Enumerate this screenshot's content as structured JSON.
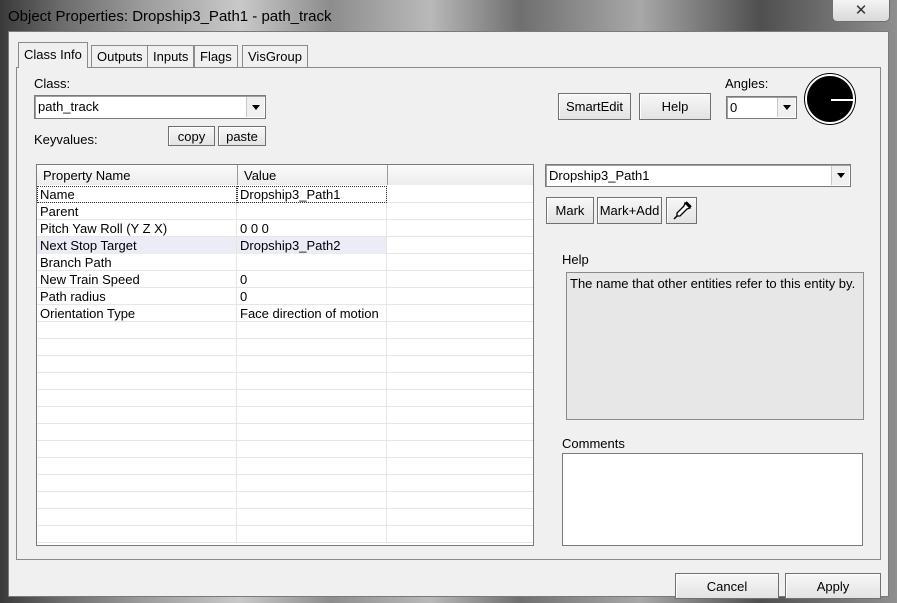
{
  "window": {
    "title": "Object Properties: Dropship3_Path1 - path_track",
    "close_glyph": "✕"
  },
  "tabs": [
    {
      "label": "Class Info",
      "active": true
    },
    {
      "label": "Outputs"
    },
    {
      "label": "Inputs"
    },
    {
      "label": "Flags"
    },
    {
      "label": "VisGroup"
    }
  ],
  "class_section": {
    "label": "Class:",
    "value": "path_track",
    "keyvalues_label": "Keyvalues:",
    "copy_label": "copy",
    "paste_label": "paste"
  },
  "toolbar": {
    "smartedit_label": "SmartEdit",
    "help_label": "Help"
  },
  "angles": {
    "label": "Angles:",
    "value": "0"
  },
  "grid": {
    "columns": [
      "Property Name",
      "Value"
    ],
    "rows": [
      {
        "name": "Name",
        "value": "Dropship3_Path1"
      },
      {
        "name": "Parent",
        "value": ""
      },
      {
        "name": "Pitch Yaw Roll (Y Z X)",
        "value": "0 0 0"
      },
      {
        "name": "Next Stop Target",
        "value": "Dropship3_Path2"
      },
      {
        "name": "Branch Path",
        "value": ""
      },
      {
        "name": "New Train Speed",
        "value": "0"
      },
      {
        "name": "Path radius",
        "value": "0"
      },
      {
        "name": "Orientation Type",
        "value": "Face direction of motion"
      }
    ]
  },
  "target": {
    "value": "Dropship3_Path1",
    "mark_label": "Mark",
    "mark_add_label": "Mark+Add",
    "picker_icon": "eyedropper-icon"
  },
  "help": {
    "label": "Help",
    "text": "The name that other entities refer to this entity by."
  },
  "comments": {
    "label": "Comments",
    "text": ""
  },
  "footer": {
    "cancel_label": "Cancel",
    "apply_label": "Apply"
  }
}
